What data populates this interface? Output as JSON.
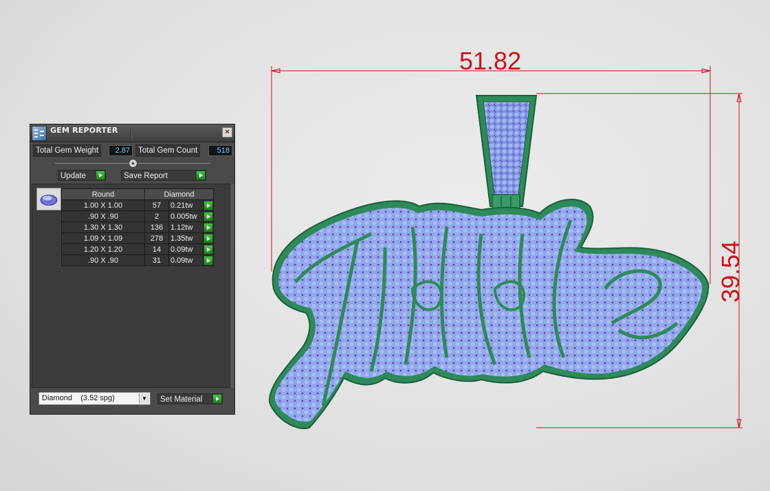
{
  "panel": {
    "title": "GEM REPORTER",
    "close_symbol": "×",
    "total_weight_label": "Total Gem Weight",
    "total_weight_value": "2.87",
    "total_count_label": "Total Gem Count",
    "total_count_value": "518",
    "update_label": "Update",
    "save_report_label": "Save Report",
    "table_headers": [
      "Round",
      "Diamond"
    ],
    "rows": [
      {
        "size": "1.00 X 1.00",
        "count": "57",
        "weight": "0.21tw"
      },
      {
        "size": ".90 X .90",
        "count": "2",
        "weight": "0.005tw"
      },
      {
        "size": "1.30 X 1.30",
        "count": "136",
        "weight": "1.12tw"
      },
      {
        "size": "1.09 X 1.09",
        "count": "278",
        "weight": "1.35tw"
      },
      {
        "size": "1.20 X 1.20",
        "count": "14",
        "weight": "0.09tw"
      },
      {
        "size": ".90 X .90",
        "count": "31",
        "weight": "0.09tw"
      }
    ],
    "material_select": "Diamond    (3.52 spg)",
    "set_material_label": "Set Material"
  },
  "viewport": {
    "width_dimension": "51.82",
    "height_dimension": "39.54",
    "dimension_color": "#c8141c",
    "metal_color": "#2e8a5a",
    "stone_color": "#8fa8ee",
    "prong_color": "#7a3a9a"
  }
}
